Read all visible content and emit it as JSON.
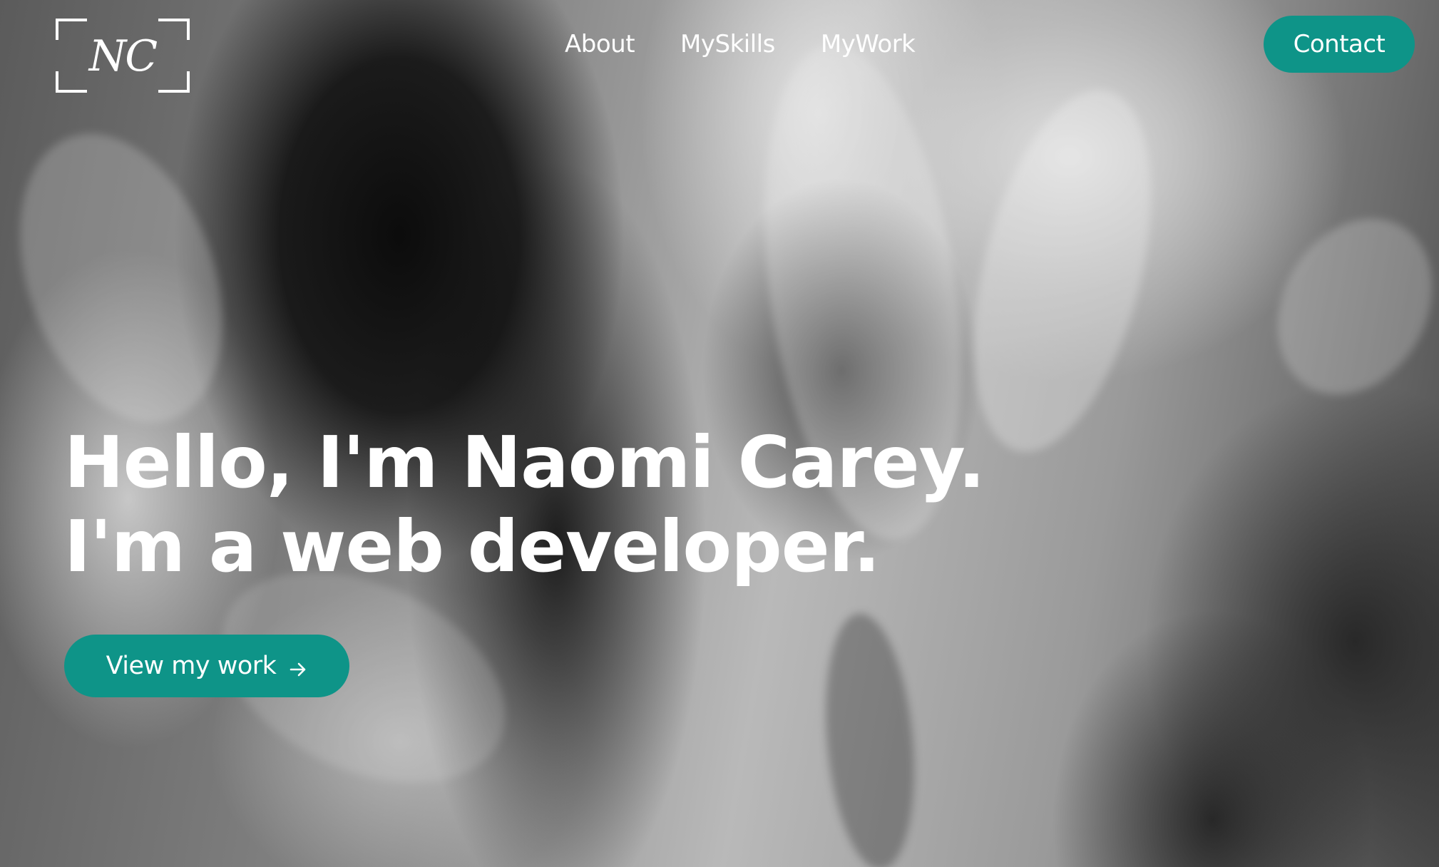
{
  "logo": {
    "monogram": "NC"
  },
  "nav": {
    "items": [
      {
        "label": "About"
      },
      {
        "label": "MySkills"
      },
      {
        "label": "MyWork"
      }
    ],
    "contact_label": "Contact"
  },
  "hero": {
    "line1": "Hello, I'm Naomi Carey.",
    "line2": "I'm a web developer.",
    "cta_label": "View my work",
    "cta_icon": "arrow-right-icon",
    "background": "black-and-white smoke photograph"
  },
  "colors": {
    "accent": "#0e9488",
    "text": "#ffffff"
  }
}
